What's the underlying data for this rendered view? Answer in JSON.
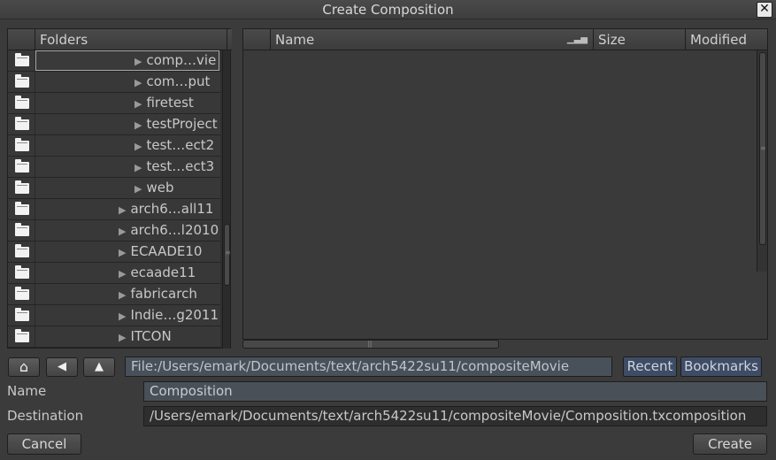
{
  "window": {
    "title": "Create Composition",
    "close_glyph": "✕"
  },
  "folders_panel": {
    "header": "Folders",
    "rows": [
      {
        "label": "comp…vie",
        "selected": true
      },
      {
        "label": "com…put"
      },
      {
        "label": "firetest"
      },
      {
        "label": "testProject"
      },
      {
        "label": "test…ect2"
      },
      {
        "label": "test…ect3"
      },
      {
        "label": "web"
      },
      {
        "label": "arch6…all11"
      },
      {
        "label": "arch6…l2010"
      },
      {
        "label": "ECAADE10"
      },
      {
        "label": "ecaade11"
      },
      {
        "label": "fabricarch"
      },
      {
        "label": "Indie…g2011"
      },
      {
        "label": "ITCON"
      }
    ]
  },
  "files_panel": {
    "columns": [
      "Name",
      "Size",
      "Modified"
    ],
    "sort_icon": "sort-bars-icon"
  },
  "nav": {
    "home_glyph": "⌂",
    "back_glyph": "◀",
    "up_glyph": "▲",
    "path": "File:/Users/emark/Documents/text/arch5422su11/compositeMovie",
    "recent_label": "Recent",
    "bookmarks_label": "Bookmarks"
  },
  "form": {
    "name_label": "Name",
    "name_value": "Composition",
    "destination_label": "Destination",
    "destination_value": "/Users/emark/Documents/text/arch5422su11/compositeMovie/Composition.txcomposition"
  },
  "actions": {
    "cancel_label": "Cancel",
    "create_label": "Create"
  },
  "colors": {
    "background": "#3b3b3b",
    "accent_button": "#3f4c66",
    "path_field": "#48505a"
  }
}
